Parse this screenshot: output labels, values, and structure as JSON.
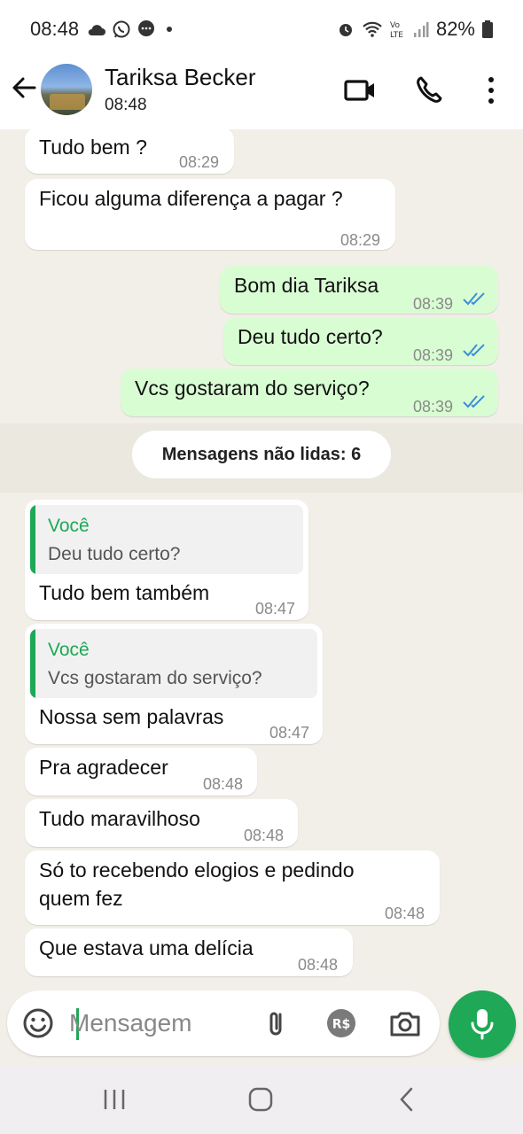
{
  "status_bar": {
    "time": "08:48",
    "battery": "82%"
  },
  "header": {
    "contact_name": "Tariksa Becker",
    "contact_status": "08:48"
  },
  "messages": [
    {
      "text": "Tudo bem ?",
      "time": "08:29"
    },
    {
      "text": "Ficou alguma diferença a pagar ?",
      "time": "08:29"
    },
    {
      "text": "Bom dia Tariksa",
      "time": "08:39"
    },
    {
      "text": "Deu tudo certo?",
      "time": "08:39"
    },
    {
      "text": "Vcs gostaram do serviço?",
      "time": "08:39"
    },
    {
      "text": "Tudo bem também",
      "time": "08:47",
      "quote_author": "Você",
      "quote_text": "Deu tudo certo?"
    },
    {
      "text": "Nossa sem palavras",
      "time": "08:47",
      "quote_author": "Você",
      "quote_text": "Vcs gostaram do serviço?"
    },
    {
      "text": "Pra agradecer",
      "time": "08:48"
    },
    {
      "text": "Tudo maravilhoso",
      "time": "08:48"
    },
    {
      "text_line1": "Só to recebendo elogios e pedindo",
      "text_line2": "quem fez",
      "time": "08:48"
    },
    {
      "text": "Que estava uma delícia",
      "time": "08:48"
    }
  ],
  "unread_divider": "Mensagens não lidas: 6",
  "composer": {
    "placeholder": "Mensagem",
    "value": ""
  },
  "icons": {
    "status": [
      "cloud-icon",
      "whatsapp-icon",
      "message-icon",
      "alarm-icon",
      "wifi-icon",
      "volte-icon",
      "signal-icon",
      "battery-icon"
    ],
    "header": [
      "back-arrow-icon",
      "video-call-icon",
      "voice-call-icon",
      "more-options-icon"
    ],
    "composer": [
      "emoji-icon",
      "attach-icon",
      "payment-icon",
      "camera-icon",
      "microphone-icon"
    ],
    "nav": [
      "recent-apps-icon",
      "home-icon",
      "nav-back-icon"
    ]
  },
  "colors": {
    "accent": "#1fa855",
    "outgoing_bubble": "#d9fdd3",
    "chat_background": "#f2efe9",
    "read_ticks": "#3b8fd9"
  }
}
